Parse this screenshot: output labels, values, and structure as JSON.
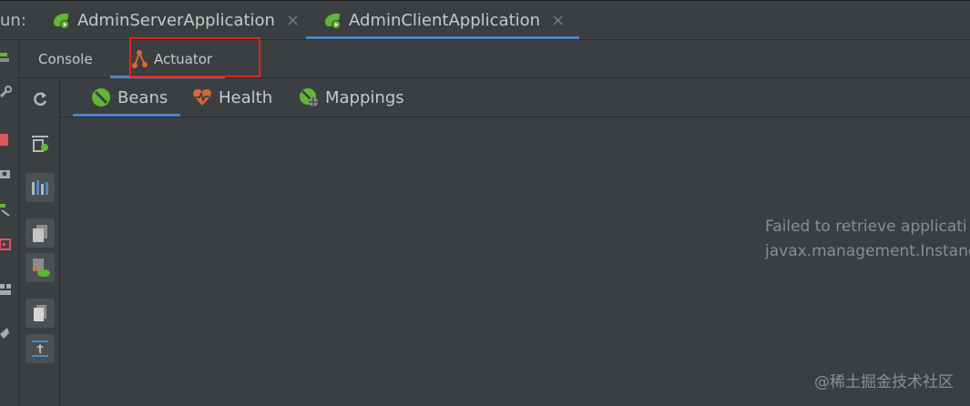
{
  "run_bar": {
    "label": "un:",
    "tabs": [
      {
        "label": "AdminServerApplication",
        "icon": "spring-boot-run-icon",
        "active": false
      },
      {
        "label": "AdminClientApplication",
        "icon": "spring-boot-run-icon",
        "active": true
      }
    ],
    "close_glyph": "×"
  },
  "sub_tabs": [
    {
      "label": "Console",
      "active": false
    },
    {
      "label": "Actuator",
      "icon": "actuator-icon",
      "active": true
    }
  ],
  "endpoint_tabs": [
    {
      "label": "Beans",
      "icon": "beans-icon",
      "active": true
    },
    {
      "label": "Health",
      "icon": "health-icon",
      "active": false
    },
    {
      "label": "Mappings",
      "icon": "mappings-icon",
      "active": false
    }
  ],
  "content": {
    "error_line1": "Failed to retrieve applicati",
    "error_line2": "javax.management.Instanc"
  },
  "watermark": "@稀土掘金技术社区",
  "colors": {
    "accent": "#4a88c7",
    "highlight": "#e0241b",
    "spring_green": "#5fb832",
    "health_orange": "#d9673a"
  }
}
